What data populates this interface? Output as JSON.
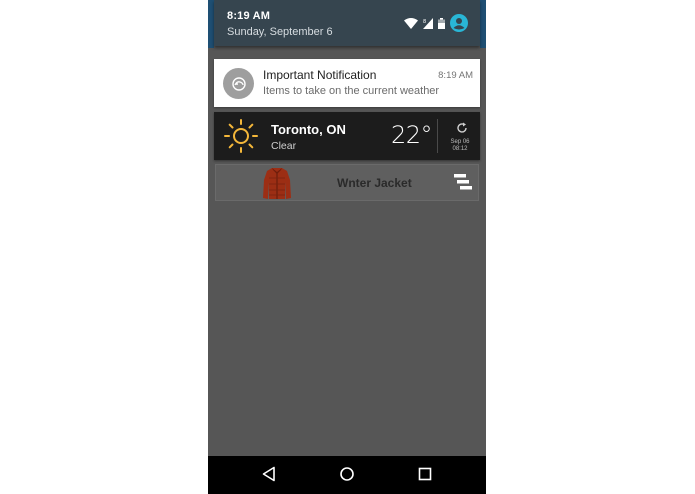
{
  "status_header": {
    "time": "8:19 AM",
    "date": "Sunday, September 6",
    "icons": [
      "wifi-icon",
      "cell-signal-icon",
      "battery-icon",
      "account-icon"
    ],
    "accent_color": "#29b6d6"
  },
  "notification": {
    "title": "Important Notification",
    "text": "Items to take on the current weather",
    "time": "8:19 AM",
    "icon": "weather-app-icon"
  },
  "weather": {
    "city": "Toronto, ON",
    "condition": "Clear",
    "temperature": "22°",
    "updated_date": "Sep 06",
    "updated_time": "08:12",
    "icon": "sun-icon",
    "sun_color": "#f4b73a"
  },
  "item": {
    "label": "Wnter Jacket",
    "image": "jacket-image",
    "menu_icon": "stacked-bars-icon"
  },
  "navigation": {
    "buttons": [
      "back-icon",
      "home-icon",
      "recents-icon"
    ]
  }
}
